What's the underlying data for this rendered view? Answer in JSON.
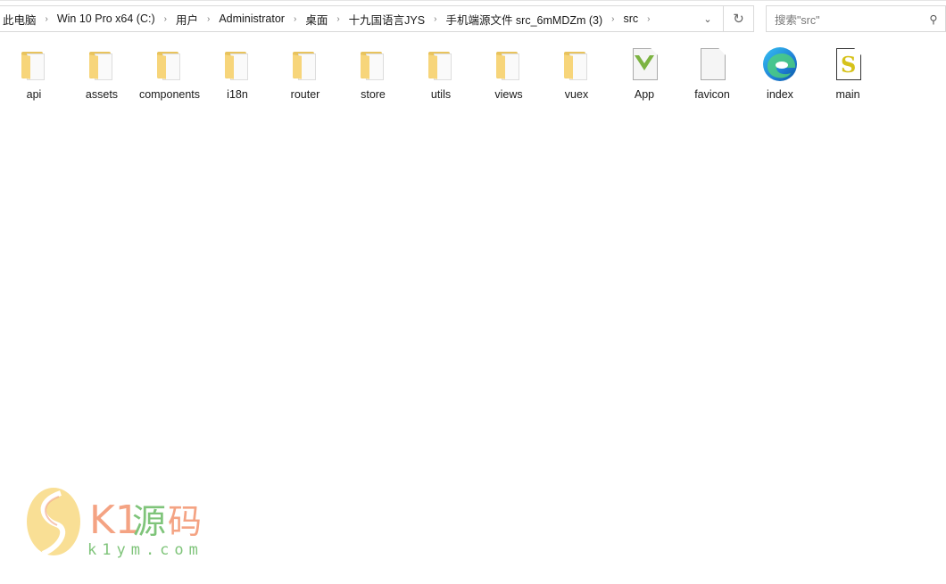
{
  "address_bar": {
    "breadcrumbs": [
      "此电脑",
      "Win 10 Pro x64 (C:)",
      "用户",
      "Administrator",
      "桌面",
      "十九国语言JYS",
      "手机端源文件 src_6mMDZm (3)",
      "src"
    ]
  },
  "search": {
    "placeholder": "搜索\"src\""
  },
  "items": [
    {
      "label": "api",
      "type": "folder"
    },
    {
      "label": "assets",
      "type": "folder"
    },
    {
      "label": "components",
      "type": "folder"
    },
    {
      "label": "i18n",
      "type": "folder"
    },
    {
      "label": "router",
      "type": "folder"
    },
    {
      "label": "store",
      "type": "folder"
    },
    {
      "label": "utils",
      "type": "folder"
    },
    {
      "label": "views",
      "type": "folder"
    },
    {
      "label": "vuex",
      "type": "folder"
    },
    {
      "label": "App",
      "type": "vue-file"
    },
    {
      "label": "favicon",
      "type": "blank-file"
    },
    {
      "label": "index",
      "type": "edge-html-file"
    },
    {
      "label": "main",
      "type": "script-file"
    }
  ],
  "watermark": {
    "brand": "K1源码",
    "url": "k1ym.com"
  }
}
